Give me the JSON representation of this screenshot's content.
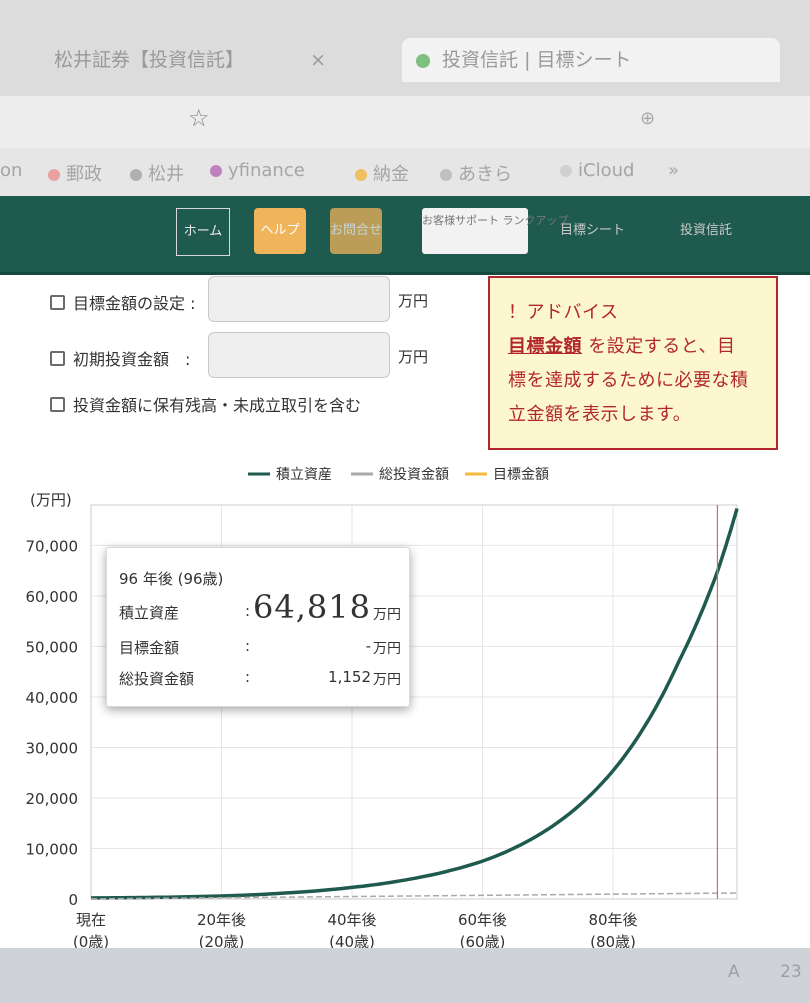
{
  "browser": {
    "tabs": [
      {
        "label": "松井証券【投資信託】",
        "close": "×"
      },
      {
        "label": "投資信託 | 目標シート",
        "close": "×"
      }
    ],
    "address_hint": "",
    "bookmarks": [
      "on",
      "郵政",
      "松井",
      "yfinance",
      "納金",
      "あきら",
      "iCloud",
      "»"
    ]
  },
  "site_nav": {
    "items": [
      "ホーム",
      "ヘルプ",
      "お問合せ",
      "お客様サポート ランクアップ",
      "目標シート",
      "投資信託"
    ]
  },
  "settings": {
    "target_amount_label": "目標金額の設定 :",
    "target_amount_value": "",
    "initial_amount_label": "初期投資金額　:",
    "initial_amount_value": "",
    "include_holdings_label": "投資金額に保有残高・未成立取引を含む",
    "unit": "万円"
  },
  "advice": {
    "title": "！アドバイス",
    "highlight": "目標金額",
    "text_after_highlight": "を設定すると、目",
    "line2": "標を達成するために必要な積",
    "line3": "立金額を表示します。"
  },
  "chart_data": {
    "type": "line",
    "y_unit_label": "(万円)",
    "legend": [
      "積立資産",
      "総投資金額",
      "目標金額"
    ],
    "colors": {
      "積立資産": "#1f5a4e",
      "総投資金額": "#aaaaaa",
      "目標金額": "#f5b93c"
    },
    "x_ticks": [
      {
        "value": 0,
        "label": "現在",
        "sub": "(0歳)"
      },
      {
        "value": 20,
        "label": "20年後",
        "sub": "(20歳)"
      },
      {
        "value": 40,
        "label": "40年後",
        "sub": "(40歳)"
      },
      {
        "value": 60,
        "label": "60年後",
        "sub": "(60歳)"
      },
      {
        "value": 80,
        "label": "80年後",
        "sub": "(80歳)"
      }
    ],
    "y_ticks": [
      0,
      10000,
      20000,
      30000,
      40000,
      50000,
      60000,
      70000
    ],
    "y_tick_labels": [
      "0",
      "10,000",
      "20,000",
      "30,000",
      "40,000",
      "50,000",
      "60,000",
      "70,000"
    ],
    "xlim": [
      0,
      99
    ],
    "ylim": [
      0,
      78000
    ],
    "grid": true,
    "cursor_x": 96,
    "series": [
      {
        "name": "積立資産",
        "x": [
          0,
          10,
          20,
          30,
          40,
          50,
          60,
          70,
          80,
          85,
          90,
          96,
          99
        ],
        "values": [
          200,
          330,
          600,
          1200,
          2300,
          4200,
          7500,
          13800,
          25400,
          34500,
          46800,
          64818,
          77300
        ]
      },
      {
        "name": "総投資金額",
        "x": [
          0,
          99
        ],
        "values": [
          12,
          1188
        ]
      },
      {
        "name": "目標金額",
        "x": [],
        "values": []
      }
    ]
  },
  "tooltip": {
    "header": "96 年後 (96歳)",
    "rows": [
      {
        "label": "積立資産",
        "value": "64,818",
        "unit": "万円",
        "big": true
      },
      {
        "label": "目標金額",
        "value": "-",
        "unit": "万円",
        "big": false
      },
      {
        "label": "総投資金額",
        "value": "1,152",
        "unit": "万円",
        "big": false
      }
    ],
    "colon": ":"
  },
  "taskbar": {
    "items": [
      "",
      "",
      "A",
      "23"
    ]
  }
}
